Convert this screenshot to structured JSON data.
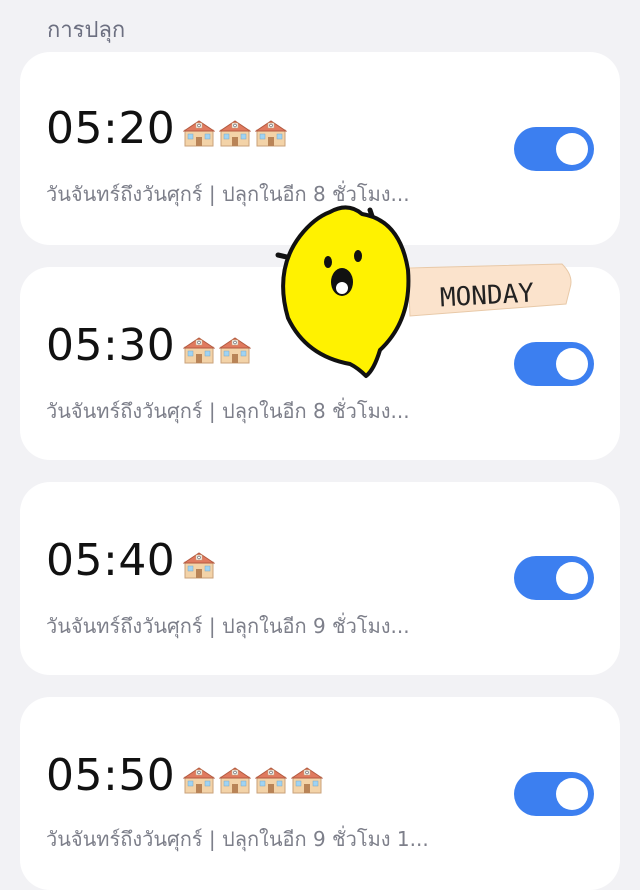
{
  "section_title": "การปลุก",
  "alarms": [
    {
      "time": "05:20",
      "icon_count": 3,
      "subtitle": "วันจันทร์ถึงวันศุกร์ | ปลุกในอีก 8 ชั่วโมง...",
      "enabled": true
    },
    {
      "time": "05:30",
      "icon_count": 2,
      "subtitle": "วันจันทร์ถึงวันศุกร์ | ปลุกในอีก 8 ชั่วโมง...",
      "enabled": true
    },
    {
      "time": "05:40",
      "icon_count": 1,
      "subtitle": "วันจันทร์ถึงวันศุกร์ | ปลุกในอีก 9 ชั่วโมง...",
      "enabled": true
    },
    {
      "time": "05:50",
      "icon_count": 4,
      "subtitle": "วันจันทร์ถึงวันศุกร์ | ปลุกในอีก 9 ชั่วโมง 1...",
      "enabled": true
    }
  ],
  "icons": {
    "alarm_label_icon": "school-icon",
    "sticker_icon": "lemon-character-icon"
  },
  "sticker": {
    "label": "MONDAY"
  },
  "colors": {
    "toggle_on": "#3c7ff0",
    "background": "#f2f2f5",
    "card": "#ffffff",
    "lemon": "#fff200",
    "tag": "#fbe3cc"
  }
}
